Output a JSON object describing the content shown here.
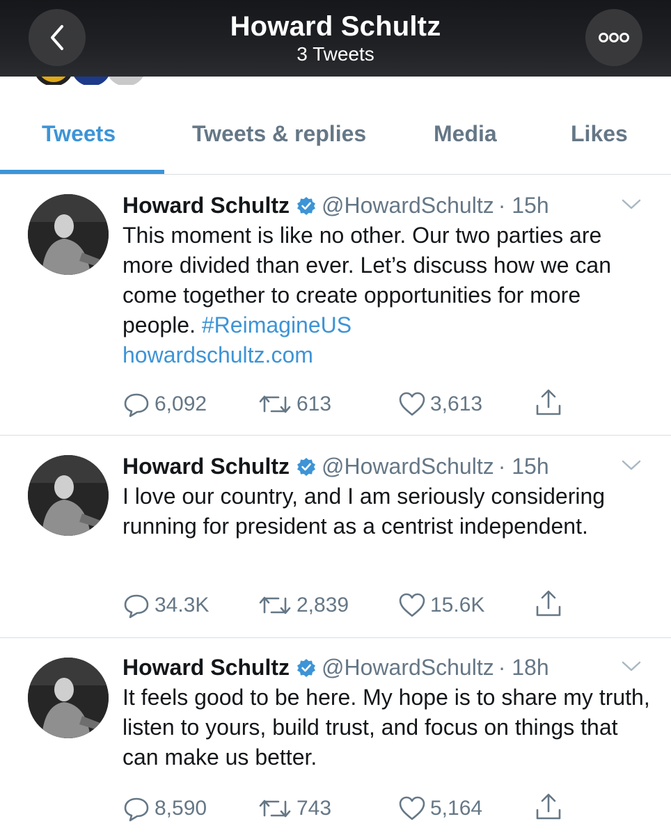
{
  "header": {
    "title": "Howard Schultz",
    "subtitle": "3 Tweets",
    "back_icon": "chevron-left-icon",
    "more_icon": "more-dots-icon"
  },
  "tabs": [
    {
      "label": "Tweets",
      "active": true
    },
    {
      "label": "Tweets & replies",
      "active": false
    },
    {
      "label": "Media",
      "active": false
    },
    {
      "label": "Likes",
      "active": false
    }
  ],
  "colors": {
    "accent": "#3d94d6",
    "muted": "#657786",
    "text": "#14171a",
    "header_bg": "#1f2125"
  },
  "tweets": [
    {
      "name": "Howard Schultz",
      "handle": "@HowardSchultz",
      "time": "· 15h",
      "text": "This moment is like no other. Our two parties are more divided than ever. Let’s discuss how we can come together to create opportunities for more people. ",
      "hashtag": "#ReimagineUS",
      "link": "howardschultz.com",
      "replies": "6,092",
      "retweets": "613",
      "likes": "3,613"
    },
    {
      "name": "Howard Schultz",
      "handle": "@HowardSchultz",
      "time": "· 15h",
      "text": "I love our country, and I am seriously considering running for president as a centrist independent.",
      "replies": "34.3K",
      "retweets": "2,839",
      "likes": "15.6K"
    },
    {
      "name": "Howard Schultz",
      "handle": "@HowardSchultz",
      "time": "· 18h",
      "text": "It feels good to be here. My hope is to share my truth, listen to yours, build trust, and focus on things that can make us better.",
      "replies": "8,590",
      "retweets": "743",
      "likes": "5,164"
    }
  ]
}
